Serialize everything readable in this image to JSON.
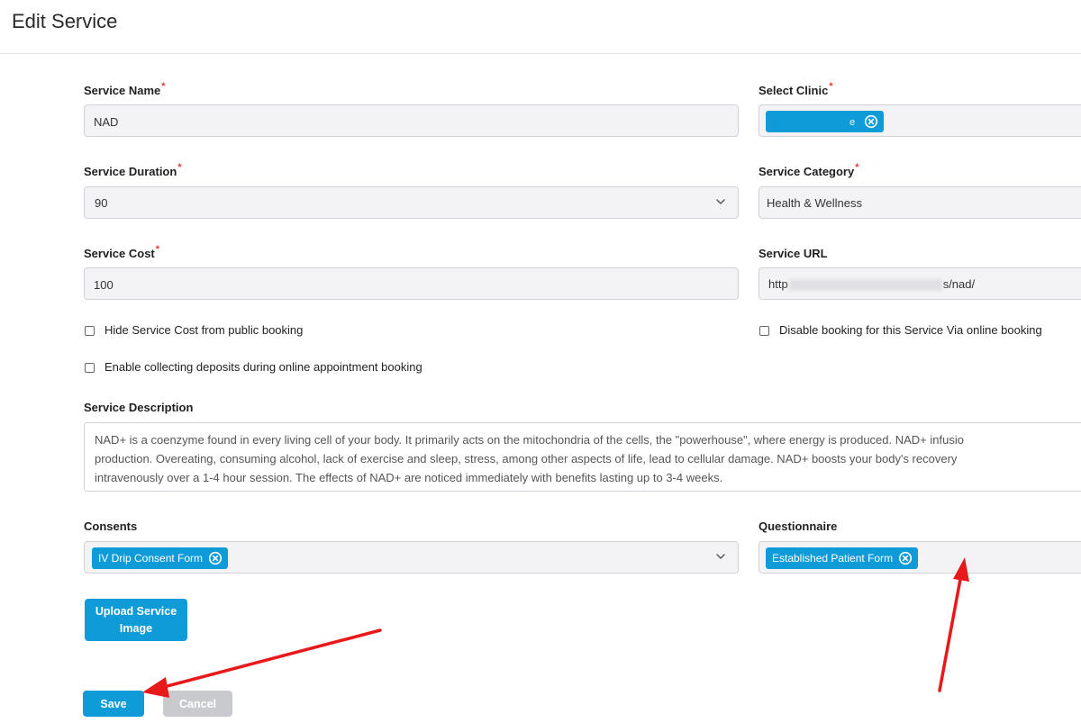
{
  "page": {
    "title": "Edit Service"
  },
  "service_name": {
    "label": "Service Name",
    "required_mark": "*",
    "value": "NAD"
  },
  "select_clinic": {
    "label": "Select Clinic",
    "required_mark": "*",
    "chip_visible_tail": "e"
  },
  "service_duration": {
    "label": "Service Duration",
    "required_mark": "*",
    "value": "90"
  },
  "service_category": {
    "label": "Service Category",
    "required_mark": "*",
    "value": "Health & Wellness"
  },
  "service_cost": {
    "label": "Service Cost",
    "required_mark": "*",
    "value": "100"
  },
  "service_url": {
    "label": "Service URL",
    "value_prefix": "http",
    "value_suffix": "s/nad/"
  },
  "checkboxes": {
    "hide_cost": {
      "label": "Hide Service Cost from public booking",
      "checked": false
    },
    "disable_booking": {
      "label": "Disable booking for this Service Via online booking",
      "checked": false
    },
    "deposits": {
      "label": "Enable collecting deposits during online appointment booking",
      "checked": false
    }
  },
  "service_description": {
    "label": "Service Description",
    "lines": [
      "NAD+ is a coenzyme found in every living cell of your body. It primarily acts on the mitochondria of the cells, the \"powerhouse\", where energy is produced. NAD+ infusio",
      "production. Overeating, consuming alcohol, lack of exercise and sleep, stress, among other aspects of life, lead to cellular damage. NAD+ boosts your body's recovery",
      "intravenously over a 1-4 hour session. The effects of NAD+ are noticed immediately with benefits lasting up to 3-4 weeks."
    ]
  },
  "consents": {
    "label": "Consents",
    "chips": [
      "IV Drip Consent Form"
    ]
  },
  "questionnaire": {
    "label": "Questionnaire",
    "chips": [
      "Established Patient Form"
    ]
  },
  "buttons": {
    "upload_line1": "Upload Service",
    "upload_line2": "Image",
    "save": "Save",
    "cancel": "Cancel"
  },
  "colors": {
    "accent": "#0e9bd8",
    "required": "#e53935",
    "annotation_arrow": "#e8191a",
    "cancel_bg": "#c8cacd"
  },
  "icons": {
    "dropdown": "chevron-down-icon",
    "chip_remove": "close-circle-icon"
  }
}
